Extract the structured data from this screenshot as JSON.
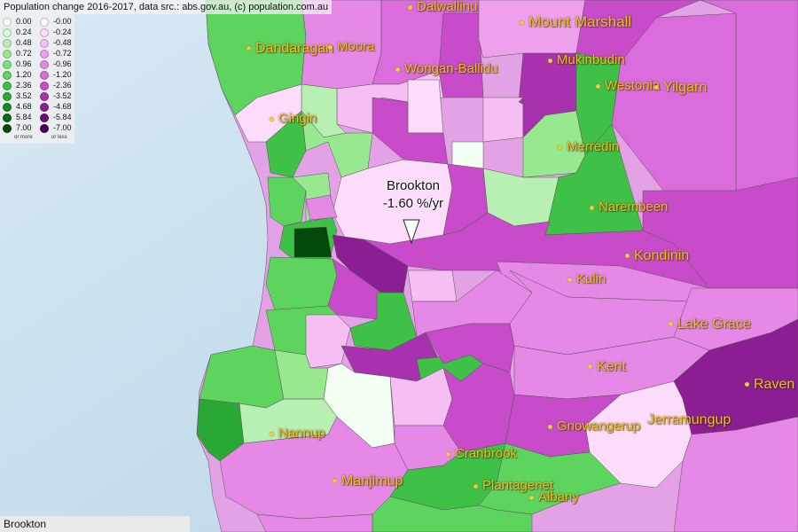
{
  "header": {
    "title": "Population change 2016-2017, data src.: abs.gov.au, (c) population.com.au"
  },
  "legend": {
    "growth": [
      {
        "label": "0.00",
        "color": "#f2fff2"
      },
      {
        "label": "0.24",
        "color": "#d8f7d8"
      },
      {
        "label": "0.48",
        "color": "#b8f0b4"
      },
      {
        "label": "0.72",
        "color": "#98e890"
      },
      {
        "label": "0.96",
        "color": "#7ee07a"
      },
      {
        "label": "1.20",
        "color": "#5cd45e"
      },
      {
        "label": "2.36",
        "color": "#3fc046"
      },
      {
        "label": "3.52",
        "color": "#2aa836"
      },
      {
        "label": "4.68",
        "color": "#168a22"
      },
      {
        "label": "5.84",
        "color": "#0a6a14"
      },
      {
        "label": "7.00",
        "color": "#034a0a"
      }
    ],
    "decline": [
      {
        "label": "-0.00",
        "color": "#fff6ff"
      },
      {
        "label": "-0.24",
        "color": "#fcdcfa"
      },
      {
        "label": "-0.48",
        "color": "#f6bff4"
      },
      {
        "label": "-0.72",
        "color": "#eea0ec"
      },
      {
        "label": "-0.96",
        "color": "#e688e6"
      },
      {
        "label": "-1.20",
        "color": "#da6cdc"
      },
      {
        "label": "-2.36",
        "color": "#c84cca"
      },
      {
        "label": "-3.52",
        "color": "#a832ae"
      },
      {
        "label": "-4.68",
        "color": "#8a1e92"
      },
      {
        "label": "-5.84",
        "color": "#6c0e76"
      },
      {
        "label": "-7.00",
        "color": "#4a0052"
      }
    ],
    "more_note": "or more",
    "less_note": "or less"
  },
  "selected_region": {
    "name": "Brookton",
    "value": "-1.60 %/yr"
  },
  "places": [
    {
      "name": "Dalwallinu"
    },
    {
      "name": "Mount Marshall"
    },
    {
      "name": "Dandaragan"
    },
    {
      "name": "Moora"
    },
    {
      "name": "Wongan-Ballidu"
    },
    {
      "name": "Mukinbudin"
    },
    {
      "name": "Westonia"
    },
    {
      "name": "Yilgarn"
    },
    {
      "name": "Gingin"
    },
    {
      "name": "Merredin"
    },
    {
      "name": "Narembeen"
    },
    {
      "name": "Kondinin"
    },
    {
      "name": "Kulin"
    },
    {
      "name": "Lake Grace"
    },
    {
      "name": "Kent"
    },
    {
      "name": "Raven"
    },
    {
      "name": "Jerramungup"
    },
    {
      "name": "Gnowangerup"
    },
    {
      "name": "Nannup"
    },
    {
      "name": "Cranbrook"
    },
    {
      "name": "Manjimup"
    },
    {
      "name": "Plantagenet"
    },
    {
      "name": "Albany"
    }
  ],
  "status_bar": {
    "text": "Brookton"
  },
  "colors": {
    "ocean": "#cfe3ef",
    "label": "#e8c020"
  }
}
